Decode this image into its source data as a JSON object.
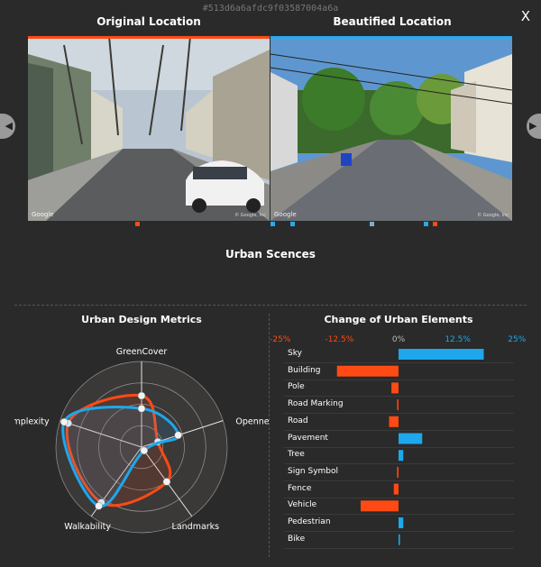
{
  "header": {
    "hash": "#513d6a6afdc9f03587004a6a",
    "close_label": "X"
  },
  "locations": {
    "original_title": "Original Location",
    "beautified_title": "Beautified Location",
    "watermark": "Google",
    "copyright": "© Google, Inc",
    "original_accent": "#ff4a14",
    "beautified_accent": "#2aa9e9"
  },
  "nav": {
    "prev_icon": "chevron-left-icon",
    "next_icon": "chevron-right-icon",
    "prev_glyph": "◀",
    "next_glyph": "▶"
  },
  "scenes": {
    "title": "Urban Scences"
  },
  "metrics": {
    "title": "Urban Design Metrics",
    "axes": [
      "GreenCover",
      "Openness",
      "Landmarks",
      "Walkability",
      "Complexity"
    ]
  },
  "elements": {
    "title": "Change of Urban Elements",
    "ticks": [
      "-25%",
      "-12.5%",
      "0%",
      "12.5%",
      "25%"
    ],
    "colors": {
      "negative": "#ff4a14",
      "positive": "#1ea7ec",
      "zero": "#bbbbbb"
    }
  },
  "chart_data": [
    {
      "type": "radar",
      "title": "Urban Design Metrics",
      "axes": [
        "GreenCover",
        "Openness",
        "Landmarks",
        "Walkability",
        "Complexity"
      ],
      "range": [
        0,
        1
      ],
      "grid": "4 rings",
      "series": [
        {
          "color": "#ff4a14",
          "values": [
            0.6,
            0.2,
            0.5,
            0.8,
            0.9
          ]
        },
        {
          "color": "#1ea7ec",
          "values": [
            0.45,
            0.45,
            0.05,
            0.85,
            0.95
          ]
        }
      ]
    },
    {
      "type": "bar",
      "title": "Change of Urban Elements",
      "orientation": "horizontal",
      "xlim": [
        -25,
        25
      ],
      "categories": [
        "Sky",
        "Building",
        "Pole",
        "Road Marking",
        "Road",
        "Pavement",
        "Tree",
        "Sign Symbol",
        "Fence",
        "Vehicle",
        "Pedestrian",
        "Bike"
      ],
      "values": [
        18,
        -13,
        -1.5,
        -0.2,
        -2,
        5,
        1,
        -0.3,
        -1,
        -8,
        1,
        0.3
      ]
    }
  ]
}
